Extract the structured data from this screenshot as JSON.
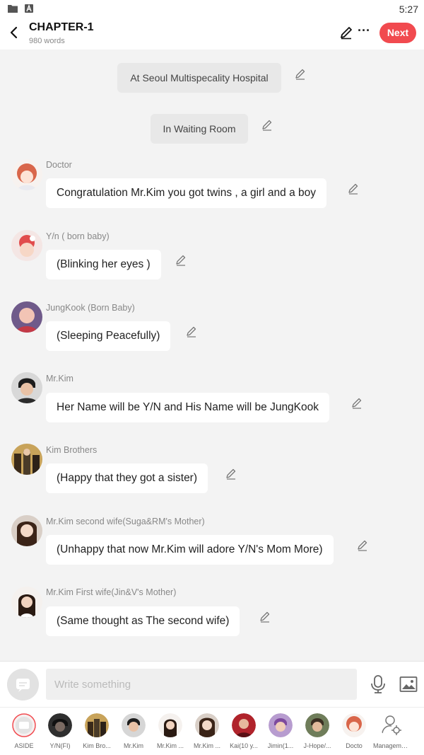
{
  "status_bar": {
    "time": "5:27"
  },
  "header": {
    "title": "CHAPTER-1",
    "word_count": "980 words",
    "next_label": "Next"
  },
  "notes": [
    {
      "text": "At Seoul Multispecality Hospital"
    },
    {
      "text": "In Waiting Room"
    }
  ],
  "messages": [
    {
      "speaker": "Doctor",
      "text": "Congratulation Mr.Kim you got twins , a girl and a boy"
    },
    {
      "speaker": "Y/n ( born baby)",
      "text": "(Blinking her eyes )"
    },
    {
      "speaker": "JungKook (Born Baby)",
      "text": "(Sleeping Peacefully)"
    },
    {
      "speaker": "Mr.Kim",
      "text": "Her Name will be Y/N and His Name will be JungKook"
    },
    {
      "speaker": "Kim Brothers",
      "text": "(Happy that they got a sister)"
    },
    {
      "speaker": "Mr.Kim second wife(Suga&RM's Mother)",
      "text": "(Unhappy that now Mr.Kim will adore Y/N's Mom More)"
    },
    {
      "speaker": "Mr.Kim First wife(Jin&V's Mother)",
      "text": "(Same thought as The second wife)"
    }
  ],
  "composer": {
    "placeholder": "Write something"
  },
  "cast_bar": [
    {
      "name": "ASIDE"
    },
    {
      "name": "Y/N(FI)"
    },
    {
      "name": "Kim Bro..."
    },
    {
      "name": "Mr.Kim"
    },
    {
      "name": "Mr.Kim ..."
    },
    {
      "name": "Mr.Kim ..."
    },
    {
      "name": "Kai(10 y..."
    },
    {
      "name": "Jimin(1..."
    },
    {
      "name": "J-Hope/..."
    },
    {
      "name": "Docto"
    },
    {
      "name": "Management"
    }
  ],
  "colors": {
    "accent": "#f14a4f",
    "background": "#f3f3f3",
    "bubble": "#ffffff",
    "note": "#e8e8e8"
  }
}
